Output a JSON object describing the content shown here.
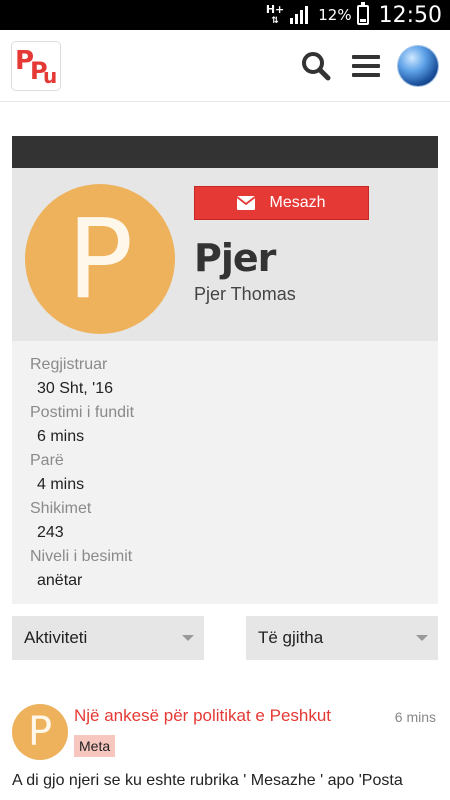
{
  "status_bar": {
    "network": "H+",
    "battery_percent": "12%",
    "time": "12:50"
  },
  "app_bar": {
    "logo_text": [
      "P",
      "P",
      "u"
    ],
    "icons": [
      "search-icon",
      "menu-icon",
      "user-avatar"
    ]
  },
  "profile": {
    "avatar_letter": "P",
    "message_button_label": "Mesazh",
    "username": "Pjer",
    "full_name": "Pjer Thomas",
    "details": [
      {
        "label": "Regjistruar",
        "value": "30 Sht, '16"
      },
      {
        "label": "Postimi i fundit",
        "value": "6 mins"
      },
      {
        "label": "Parë",
        "value": "4 mins"
      },
      {
        "label": "Shikimet",
        "value": "243"
      },
      {
        "label": "Niveli i besimit",
        "value": "anëtar"
      }
    ]
  },
  "filters": {
    "activity_select": "Aktiviteti",
    "scope_select": "Të gjitha"
  },
  "post": {
    "avatar_letter": "P",
    "title": "Një ankesë për politikat e Peshkut",
    "time": "6 mins",
    "category": "Meta",
    "excerpt": "A di gjo njeri se ku eshte rubrika ' Mesazhe ' apo 'Posta"
  },
  "colors": {
    "accent": "#e53935",
    "avatar": "#eeb25c",
    "panel": "#e6e6e6",
    "header_bar": "#333333",
    "tag_bg": "#f7c6bf"
  }
}
